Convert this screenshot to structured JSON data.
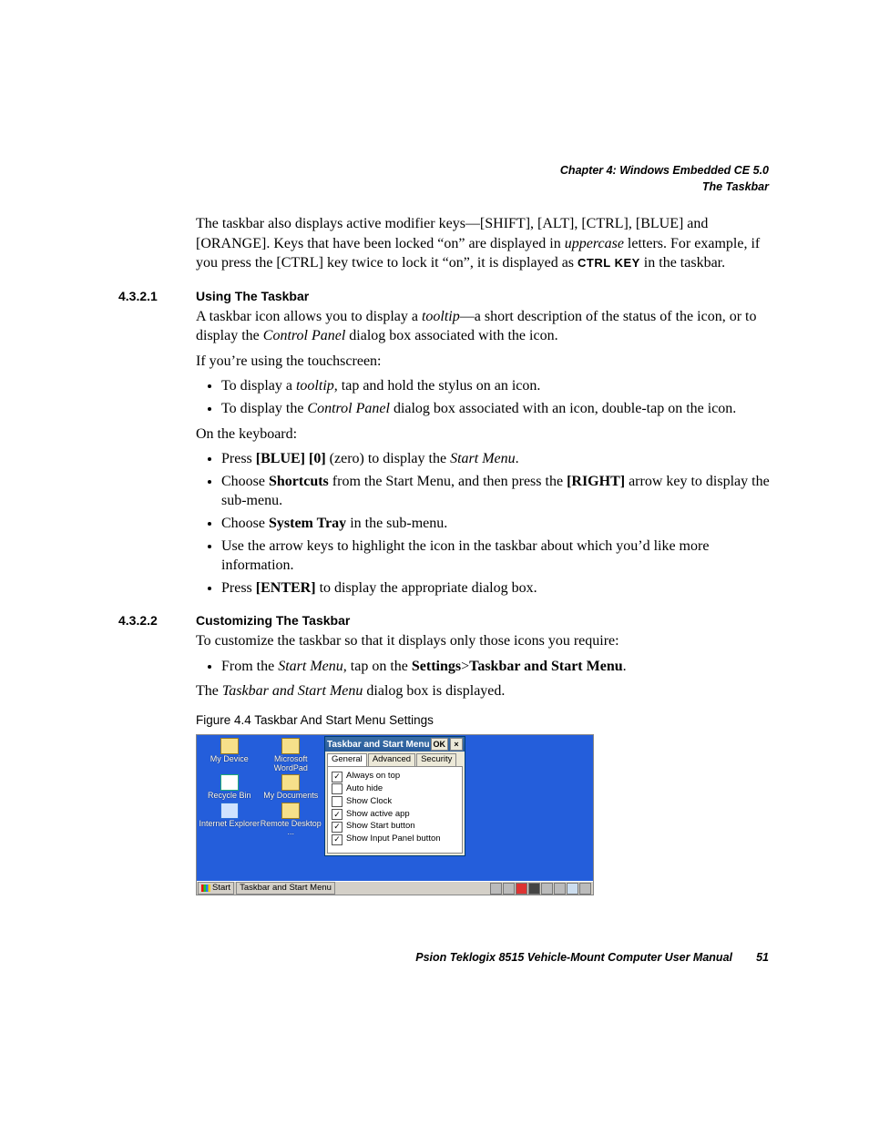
{
  "header": {
    "chapter": "Chapter 4: Windows Embedded CE 5.0",
    "section": "The Taskbar"
  },
  "intro": {
    "p1_a": "The taskbar also displays active modifier keys—[SHIFT], [ALT], [CTRL], [BLUE] and [ORANGE]. Keys that have been locked “on” are displayed in ",
    "p1_italic": "uppercase",
    "p1_b": " letters. For example, if you press the [CTRL] key twice to lock it “on”, it is displayed as ",
    "p1_sans": "CTRL KEY",
    "p1_c": " in the taskbar."
  },
  "s4321": {
    "num": "4.3.2.1",
    "title": "Using The Taskbar",
    "p1_a": "A taskbar icon allows you to display a ",
    "p1_italic1": "tooltip",
    "p1_b": "—a short description of the status of the icon, or to display the ",
    "p1_italic2": "Control Panel",
    "p1_c": " dialog box associated with the icon.",
    "p2": "If you’re using the touchscreen:",
    "bul1_a": "To display a ",
    "bul1_italic": "tooltip",
    "bul1_b": ", tap and hold the stylus on an icon.",
    "bul2_a": "To display the ",
    "bul2_italic": "Control Panel",
    "bul2_b": " dialog box associated with an icon, double-tap on the icon.",
    "p3": "On the keyboard:",
    "kb1_a": "Press ",
    "kb1_bold": "[BLUE] [0]",
    "kb1_b": " (zero) to display the ",
    "kb1_italic": "Start Menu",
    "kb1_c": ".",
    "kb2_a": "Choose ",
    "kb2_bold1": "Shortcuts",
    "kb2_b": " from the Start Menu, and then press the ",
    "kb2_bold2": "[RIGHT]",
    "kb2_c": " arrow key to display the sub-menu.",
    "kb3_a": "Choose ",
    "kb3_bold": "System Tray",
    "kb3_b": " in the sub-menu.",
    "kb4": "Use the arrow keys to highlight the icon in the taskbar about which you’d like more information.",
    "kb5_a": "Press ",
    "kb5_bold": "[ENTER]",
    "kb5_b": " to display the appropriate dialog box."
  },
  "s4322": {
    "num": "4.3.2.2",
    "title": "Customizing The Taskbar",
    "p1": "To customize the taskbar so that it displays only those icons you require:",
    "bul1_a": "From the ",
    "bul1_italic": "Start Menu",
    "bul1_b": ", tap on the ",
    "bul1_bold1": "Settings",
    "bul1_gt": ">",
    "bul1_bold2": "Taskbar and Start Menu",
    "bul1_c": ".",
    "p2_a": "The ",
    "p2_italic": "Taskbar and Start Menu",
    "p2_b": " dialog box is displayed.",
    "figcap": "Figure 4.4  Taskbar And Start Menu Settings"
  },
  "shot": {
    "icons": {
      "mydevice": "My Device",
      "wordpad": "Microsoft WordPad",
      "recycle": "Recycle Bin",
      "mydocs": "My Documents",
      "ie": "Internet Explorer",
      "remote": "Remote Desktop ..."
    },
    "dialog": {
      "title": "Taskbar and Start Menu",
      "ok": "OK",
      "tabs": {
        "general": "General",
        "advanced": "Advanced",
        "security": "Security"
      },
      "opts": {
        "ontop": {
          "label": "Always on top",
          "checked": true
        },
        "autohide": {
          "label": "Auto hide",
          "checked": false
        },
        "clock": {
          "label": "Show Clock",
          "checked": false
        },
        "active": {
          "label": "Show active app",
          "checked": true
        },
        "start": {
          "label": "Show Start button",
          "checked": true
        },
        "input": {
          "label": "Show Input Panel button",
          "checked": true
        }
      }
    },
    "taskbar": {
      "start": "Start",
      "task": "Taskbar and Start Menu"
    }
  },
  "footer": {
    "text": "Psion Teklogix 8515 Vehicle-Mount Computer User Manual",
    "page": "51"
  }
}
